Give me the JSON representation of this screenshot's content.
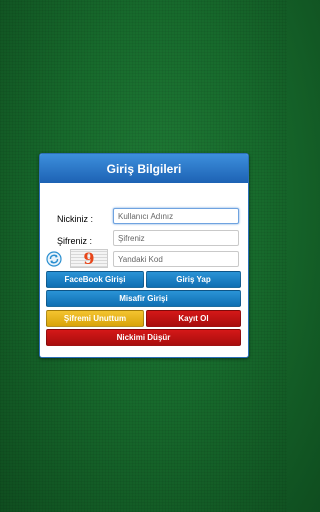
{
  "panel": {
    "title": "Giriş Bilgileri"
  },
  "form": {
    "nick_label": "Nickiniz :",
    "nick_placeholder": "Kullanıcı Adınız",
    "password_label": "Şifreniz :",
    "password_placeholder": "Şifreniz",
    "captcha_placeholder": "Yandaki Kod",
    "captcha_value": "9"
  },
  "buttons": {
    "facebook": "FaceBook Girişi",
    "login": "Giriş Yap",
    "guest": "Misafir Girişi",
    "forgot": "Şifremi Unuttum",
    "register": "Kayıt Ol",
    "drop_nick": "Nickimi Düşür"
  },
  "colors": {
    "blue": "#1a7fc8",
    "gold": "#e8b51a",
    "red": "#c01212",
    "background": "#176a2c"
  }
}
